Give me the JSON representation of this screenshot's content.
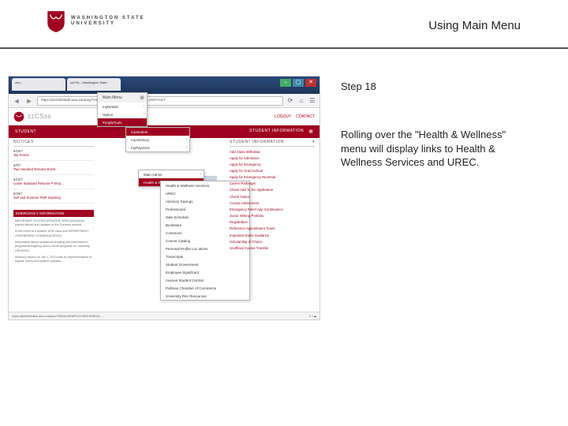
{
  "header": {
    "university": "WASHINGTON STATE",
    "university_sub": "UNIVERSITY",
    "title": "Using Main Menu",
    "step": "Step 18",
    "description": "Rolling over the \"Health & Wellness\" menu will display links to Health & Wellness Services and UREC."
  },
  "browser": {
    "tabs": [
      "crtu…",
      "zzCSs - Washington State"
    ],
    "url": "https://psxhibintwb.wsu.edu/psp/TAKA01/EMPLOYEE/HRMS/h/?tab=DEFAULT",
    "status_left": "https://psxhibintwb.wsu.edu/psc/TAKA01/EMPLOYEE/HRMS/c/…",
    "status_right": "⟟ ⌂ ☰"
  },
  "app": {
    "name": "zzCSss",
    "right_links": [
      "LOGOUT",
      "CONTACT"
    ]
  },
  "redbar": {
    "left": "STUDENT",
    "right_label": "STUDENT INFORMATION"
  },
  "notices": {
    "heading": "NOTICES",
    "items": [
      {
        "d": "9/16/7",
        "t": "Tax Forms"
      },
      {
        "d": "9/9/7",
        "t": "Two Hundred Resume Event"
      },
      {
        "d": "9/10/7",
        "t": "Leave Standard Resume P Emp…"
      },
      {
        "d": "8/29/7",
        "t": "Self and Summer PMP Stacking"
      }
    ]
  },
  "emergency": {
    "heading": "EMERGENCY INFORMATION",
    "lines": [
      "IMPORTANT SYSTEM UPDATES: WSU announces placed offices and updates in the Currents section.",
      "In the event of a system WSU uses and DEPARTMENT OVERSEEING COMMUNICATION.",
      "Information about occasional flooding can retirement to program/emergency and to some programs in University UPDATES.",
      "Advisory issued on Jan 1, 2013 was for implementation of regular hourly and system updates."
    ]
  },
  "menus": {
    "m1": {
      "head": "Main Menu",
      "items": [
        "myDetails",
        "Option",
        "PeopleTools"
      ],
      "hi": "PeopleTools"
    },
    "m2": {
      "items": [
        "myStudent",
        "myAdvisory",
        "myPayment"
      ],
      "hi": "myStudent"
    },
    "m3": {
      "items": [
        "Main Admin",
        "Health & Wellness"
      ],
      "hi": "Health & Wellness"
    },
    "m4": {
      "items": [
        "Health & Wellness Services",
        "UREC",
        "Advisory Savings",
        "Professional",
        "Sale Schedule",
        "Bookstore",
        "Commons",
        "Course Catalog",
        "Personal Profile Loc ations",
        "Transcripts",
        "Student Government",
        "Employee Significant",
        "Avenue Student Central",
        "Pullman Chamber of Commerce",
        "University Rec Resources"
      ]
    }
  },
  "rightcol": {
    "heading": "STUDENT INFORMATION",
    "links": [
      "Add Class Withdraw",
      "Apply for Admission",
      "Apply for Emergency",
      "Apply for Grad School",
      "Apply for Emergency Reversal",
      "Career Pathways",
      "Check Add To Do Application",
      "Check Tuition",
      "Course Advisement",
      "Emergency Relief App Continuance",
      "Junior Writing Portfolio",
      "Registration",
      "Reference Appointment Times",
      "Important Dates Guidance",
      "Scholarship of Choice",
      "Unofficial Course Transfer"
    ]
  }
}
